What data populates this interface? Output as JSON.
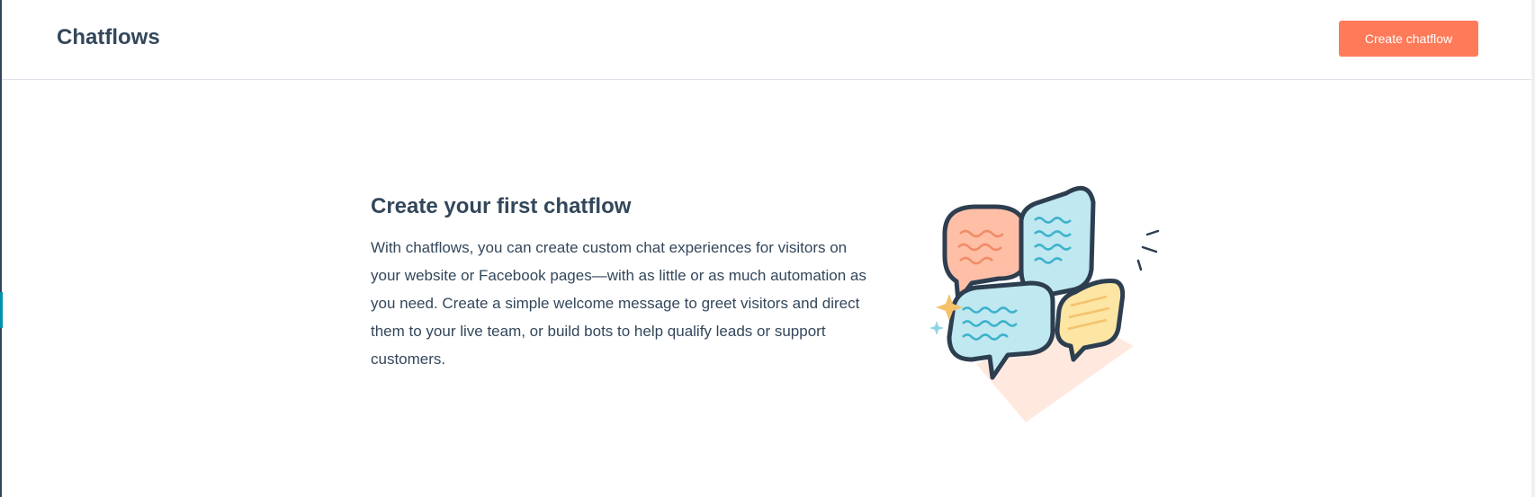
{
  "header": {
    "title": "Chatflows",
    "create_button_label": "Create chatflow"
  },
  "empty_state": {
    "title": "Create your first chatflow",
    "description": "With chatflows, you can create custom chat experiences for visitors on your website or Facebook pages—with as little or as much automation as you need. Create a simple welcome message to greet visitors and direct them to your live team, or build bots to help qualify leads or support customers.",
    "illustration_icon": "chat-bubbles-illustration"
  },
  "colors": {
    "primary_button": "#ff7a59",
    "text": "#33475b",
    "divider": "#dfe3eb",
    "bubble_blue": "#bfe8f0",
    "bubble_orange": "#ffbfa6",
    "bubble_yellow": "#fde5a3",
    "sparkle": "#f5c26b"
  }
}
